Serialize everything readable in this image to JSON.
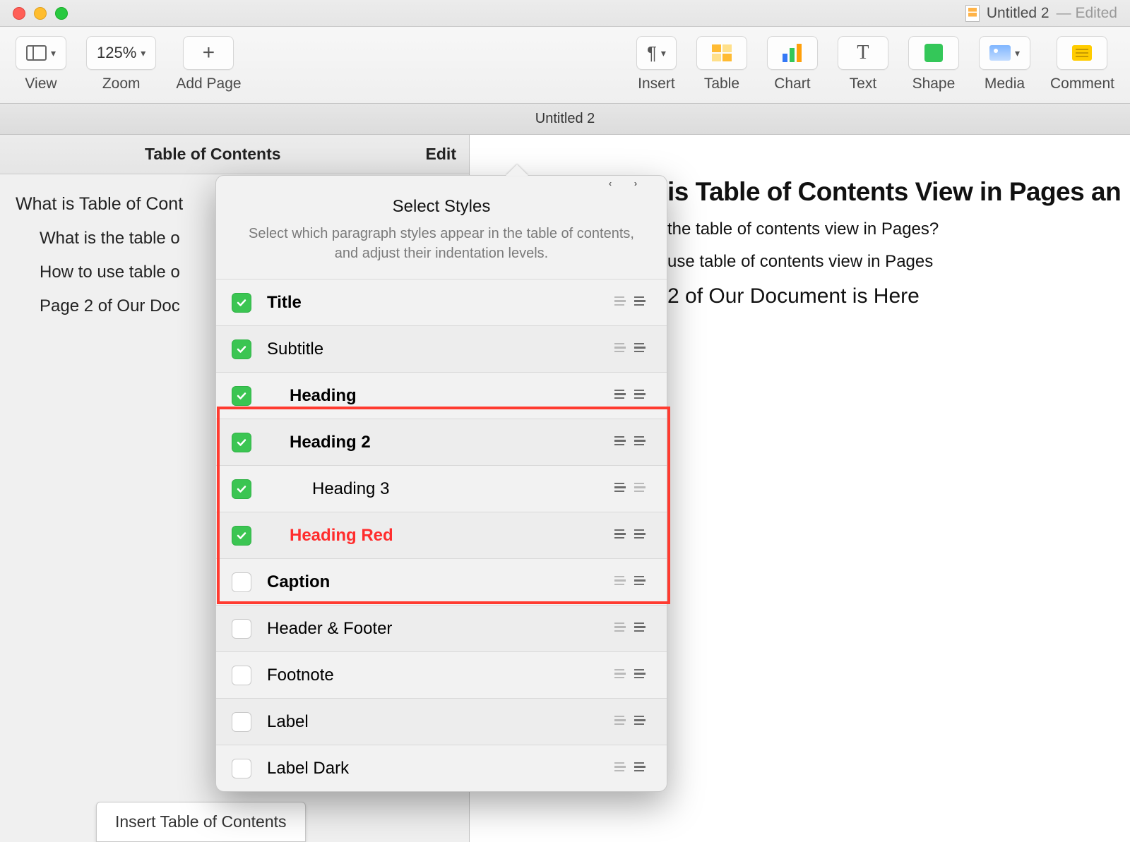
{
  "window": {
    "title": "Untitled 2",
    "edited_suffix": "— Edited"
  },
  "toolbar": {
    "view_label": "View",
    "zoom_value": "125%",
    "zoom_label": "Zoom",
    "add_page_label": "Add Page",
    "insert_label": "Insert",
    "table_label": "Table",
    "chart_label": "Chart",
    "text_label": "Text",
    "shape_label": "Shape",
    "media_label": "Media",
    "comment_label": "Comment"
  },
  "tabstrip": {
    "tab1": "Untitled 2"
  },
  "sidebar": {
    "title": "Table of Contents",
    "edit_label": "Edit",
    "toc": [
      {
        "text": "What is Table of Cont",
        "level": 1
      },
      {
        "text": "What is the table o",
        "level": 2
      },
      {
        "text": "How to use table o",
        "level": 2
      },
      {
        "text": "Page 2 of Our Doc",
        "level": 2
      }
    ],
    "insert_btn": "Insert Table of Contents"
  },
  "popover": {
    "title": "Select Styles",
    "description": "Select which paragraph styles appear in the table of contents, and adjust their indentation levels.",
    "styles": [
      {
        "name": "Title",
        "checked": true,
        "bold": true,
        "indent": 0,
        "can_outdent": false,
        "can_indent": true
      },
      {
        "name": "Subtitle",
        "checked": true,
        "bold": false,
        "indent": 0,
        "can_outdent": false,
        "can_indent": true
      },
      {
        "name": "Heading",
        "checked": true,
        "bold": true,
        "indent": 1,
        "can_outdent": true,
        "can_indent": true
      },
      {
        "name": "Heading 2",
        "checked": true,
        "bold": true,
        "indent": 1,
        "can_outdent": true,
        "can_indent": true
      },
      {
        "name": "Heading 3",
        "checked": true,
        "bold": false,
        "indent": 2,
        "can_outdent": true,
        "can_indent": false
      },
      {
        "name": "Heading Red",
        "checked": true,
        "bold": true,
        "indent": 1,
        "red": true,
        "can_outdent": true,
        "can_indent": true
      },
      {
        "name": "Caption",
        "checked": false,
        "bold": true,
        "indent": 0,
        "can_outdent": false,
        "can_indent": true
      },
      {
        "name": "Header & Footer",
        "checked": false,
        "bold": false,
        "indent": 0,
        "can_outdent": false,
        "can_indent": true
      },
      {
        "name": "Footnote",
        "checked": false,
        "bold": false,
        "indent": 0,
        "can_outdent": false,
        "can_indent": true
      },
      {
        "name": "Label",
        "checked": false,
        "bold": false,
        "indent": 0,
        "selected": true,
        "can_outdent": false,
        "can_indent": true
      },
      {
        "name": "Label Dark",
        "checked": false,
        "bold": false,
        "indent": 0,
        "can_outdent": false,
        "can_indent": true
      }
    ]
  },
  "document": {
    "title": "is Table of Contents View in Pages an",
    "sub1": "the table of contents view in Pages?",
    "sub2": "use table of contents view in Pages",
    "h2": "2 of Our Document is Here"
  }
}
